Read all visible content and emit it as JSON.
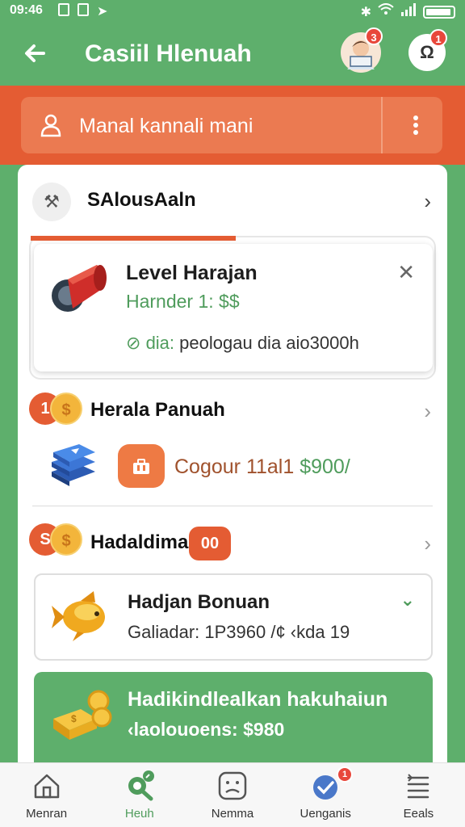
{
  "status_bar": {
    "time": "09:46"
  },
  "app_bar": {
    "title": "Casiil Hlenuah",
    "avatar_badge": "3",
    "profile_badge": "1",
    "profile_glyph": "Ω"
  },
  "banner": {
    "label": "Manal kannali mani"
  },
  "sections": {
    "first": {
      "title": "SAlousAaln"
    },
    "level": {
      "title": "Level Harajan",
      "subtitle": "Harnder 1: $$",
      "status_prefix": "dia:",
      "status_text": "peologau dia aio3000h"
    },
    "second": {
      "title": "Herala Panuah",
      "badge_a": "1",
      "badge_b": "$",
      "cash_label": "Cogour 11al1",
      "cash_amount": "$900/"
    },
    "third": {
      "title": "Hadaldima",
      "badge_a": "S",
      "badge_b": "$",
      "tag": "00",
      "bonus_title": "Hadjan Bonuan",
      "bonus_sub": "Galiadar: 1P3960 /¢ ‹kda 19"
    },
    "reward": {
      "title": "Hadikindlealkan hakuhaiun",
      "subtitle": "‹laolouoens: $980"
    }
  },
  "bottom_nav": [
    {
      "label": "Menran",
      "icon": "home-icon",
      "active": false
    },
    {
      "label": "Heuh",
      "icon": "search-icon",
      "active": true
    },
    {
      "label": "Nemma",
      "icon": "face-icon",
      "active": false
    },
    {
      "label": "Uenganis",
      "icon": "shield-check-icon",
      "active": false,
      "badge": "1"
    },
    {
      "label": "Eeals",
      "icon": "list-icon",
      "active": false
    }
  ],
  "colors": {
    "primary_green": "#5eaf6c",
    "accent_orange": "#e45c33",
    "badge_red": "#e8473b"
  }
}
